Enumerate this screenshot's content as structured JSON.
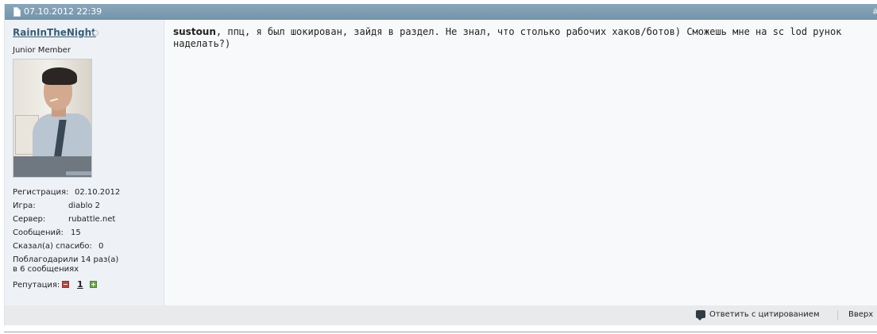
{
  "header": {
    "date": "07.10.2012 22:39",
    "post_number": "#"
  },
  "user": {
    "name": "RainInTheNight",
    "title": "Junior Member",
    "stats": [
      {
        "key": "Регистрация:",
        "value": "02.10.2012"
      },
      {
        "key": "Игра:",
        "value": "diablo 2"
      },
      {
        "key": "Сервер:",
        "value": "rubattle.net"
      },
      {
        "key": "Сообщений:",
        "value": "15"
      },
      {
        "key": "Сказал(а) спасибо:",
        "value": "0"
      }
    ],
    "thanked_line1": "Поблагодарили 14 раз(а)",
    "thanked_line2": "в 6 сообщениях",
    "reputation_label": "Репутация:",
    "reputation_value": "1"
  },
  "post": {
    "mention": "sustoun",
    "text_line1": ", ппц, я был шокирован, зайдя в раздел. Не знал, что столько рабочих хаков/ботов) Сможешь мне на sc lod рунок",
    "text_line2": "наделать?)"
  },
  "footer": {
    "quote_label": "Ответить с цитированием",
    "top_label": "Вверх"
  },
  "icons": {
    "post_icon": "document-icon",
    "online_status": "offline-dot-icon",
    "quote": "speech-bubble-icon"
  },
  "colors": {
    "header_bg": "#7f9db2",
    "username": "#3a5c75",
    "rep_minus": "#b04a4a",
    "rep_plus": "#6fa44f"
  }
}
